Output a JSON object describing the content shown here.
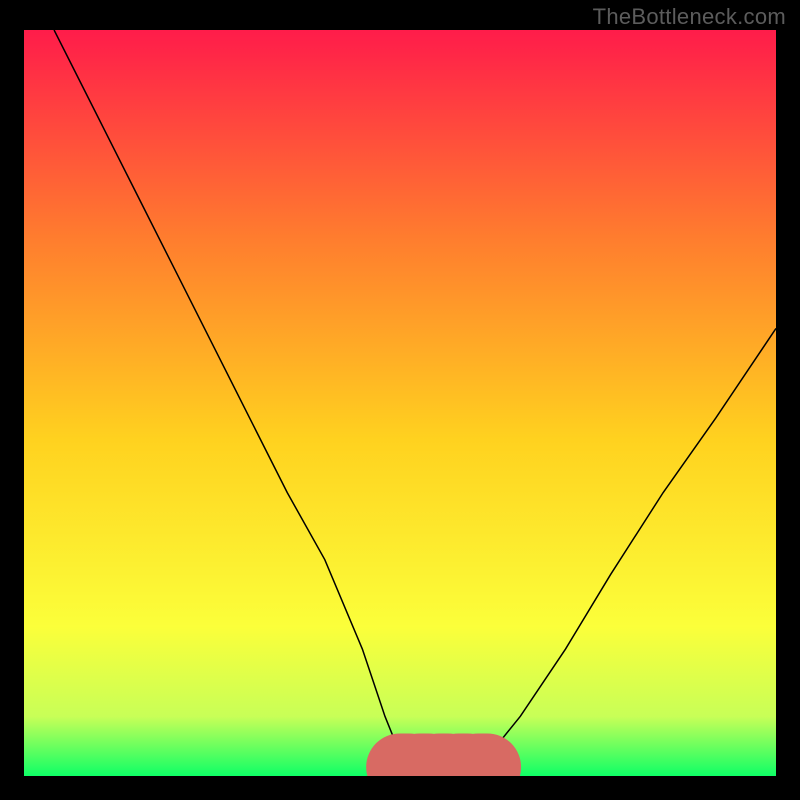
{
  "watermark": "TheBottleneck.com",
  "colors": {
    "background": "#000000",
    "gradient_top": "#ff1c4a",
    "gradient_mid_upper": "#ff7d2e",
    "gradient_mid": "#ffd21f",
    "gradient_mid_lower": "#fbff3a",
    "gradient_lower": "#c8ff57",
    "gradient_bottom": "#0fff66",
    "curve": "#000000",
    "marker": "#d86a63"
  },
  "chart_data": {
    "type": "line",
    "title": "",
    "xlabel": "",
    "ylabel": "",
    "xlim": [
      0,
      100
    ],
    "ylim": [
      0,
      100
    ],
    "grid": false,
    "series": [
      {
        "name": "bottleneck-curve",
        "x": [
          4,
          10,
          15,
          20,
          25,
          30,
          35,
          40,
          45,
          48,
          50,
          52,
          54,
          56,
          58,
          60,
          62,
          66,
          72,
          78,
          85,
          92,
          100
        ],
        "y": [
          100,
          88,
          78,
          68,
          58,
          48,
          38,
          29,
          17,
          8,
          3,
          1,
          0,
          0,
          0,
          1,
          3,
          8,
          17,
          27,
          38,
          48,
          60
        ]
      }
    ],
    "annotations": [
      {
        "name": "optimal-band",
        "type": "segment",
        "x": [
          50,
          62
        ],
        "y": [
          1.2,
          1.2
        ]
      }
    ]
  }
}
